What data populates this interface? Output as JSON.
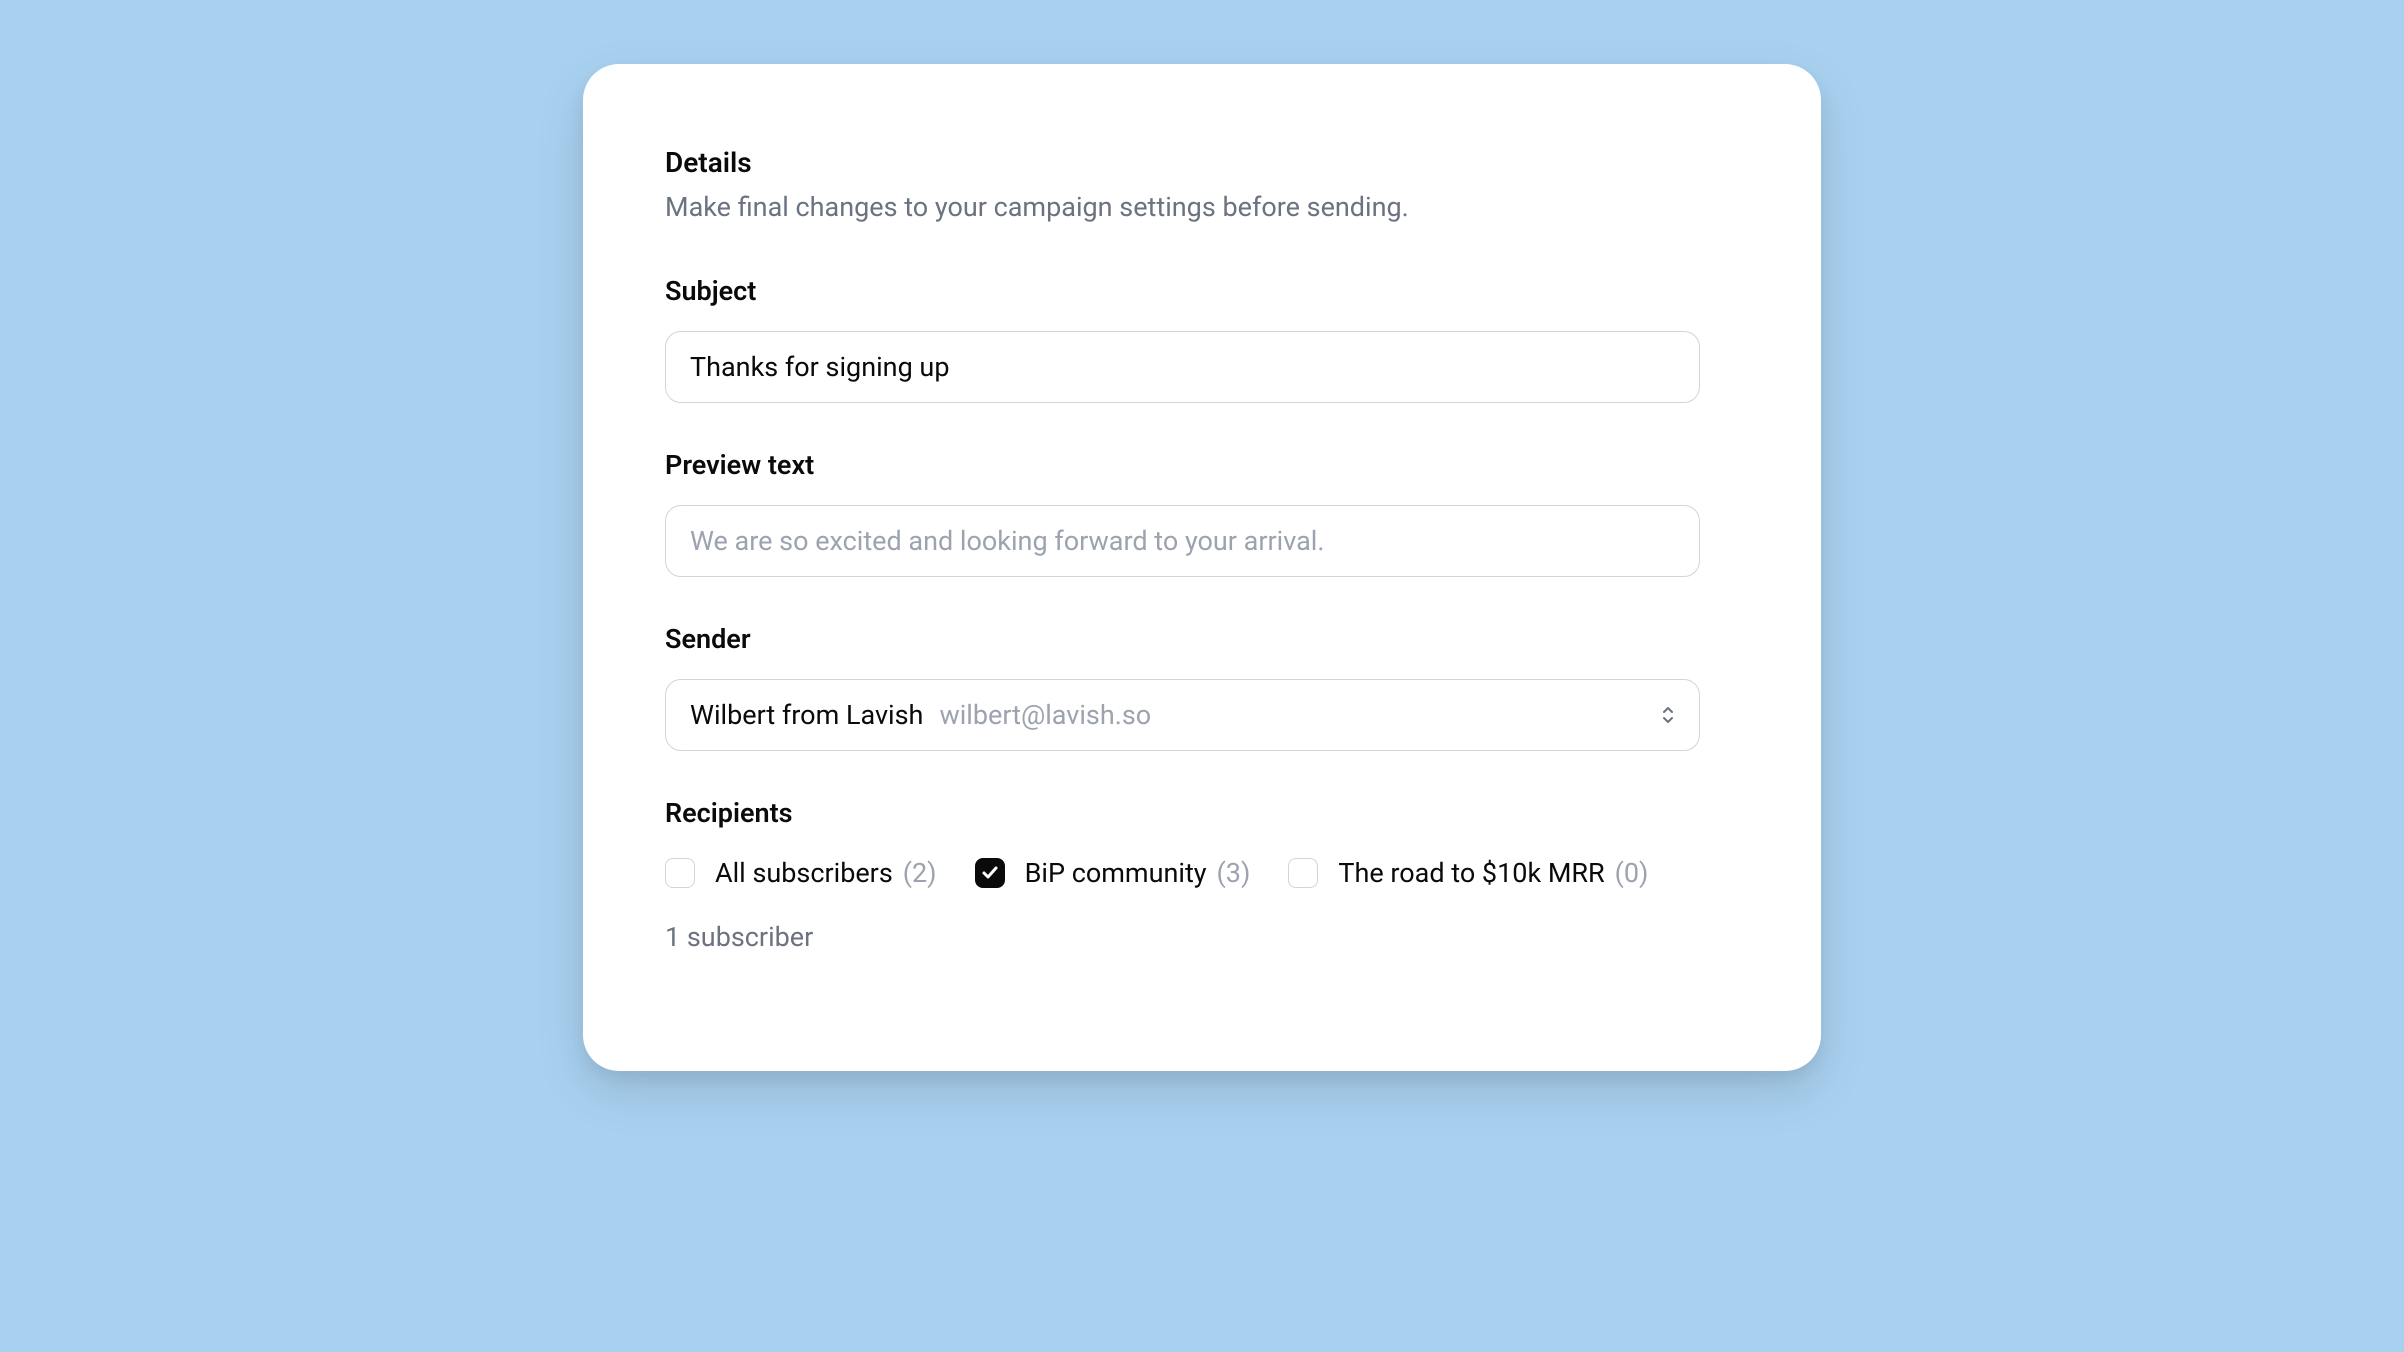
{
  "header": {
    "title": "Details",
    "subtitle": "Make final changes to your campaign settings before sending."
  },
  "subject": {
    "label": "Subject",
    "value": "Thanks for signing up"
  },
  "preview": {
    "label": "Preview text",
    "placeholder": "We are so excited and looking forward to your arrival."
  },
  "sender": {
    "label": "Sender",
    "name": "Wilbert from Lavish",
    "email": "wilbert@lavish.so"
  },
  "recipients": {
    "label": "Recipients",
    "items": [
      {
        "label": "All subscribers",
        "count": "(2)",
        "checked": false
      },
      {
        "label": "BiP community",
        "count": "(3)",
        "checked": true
      },
      {
        "label": "The road to $10k MRR",
        "count": "(0)",
        "checked": false
      }
    ],
    "summary": "1 subscriber"
  }
}
